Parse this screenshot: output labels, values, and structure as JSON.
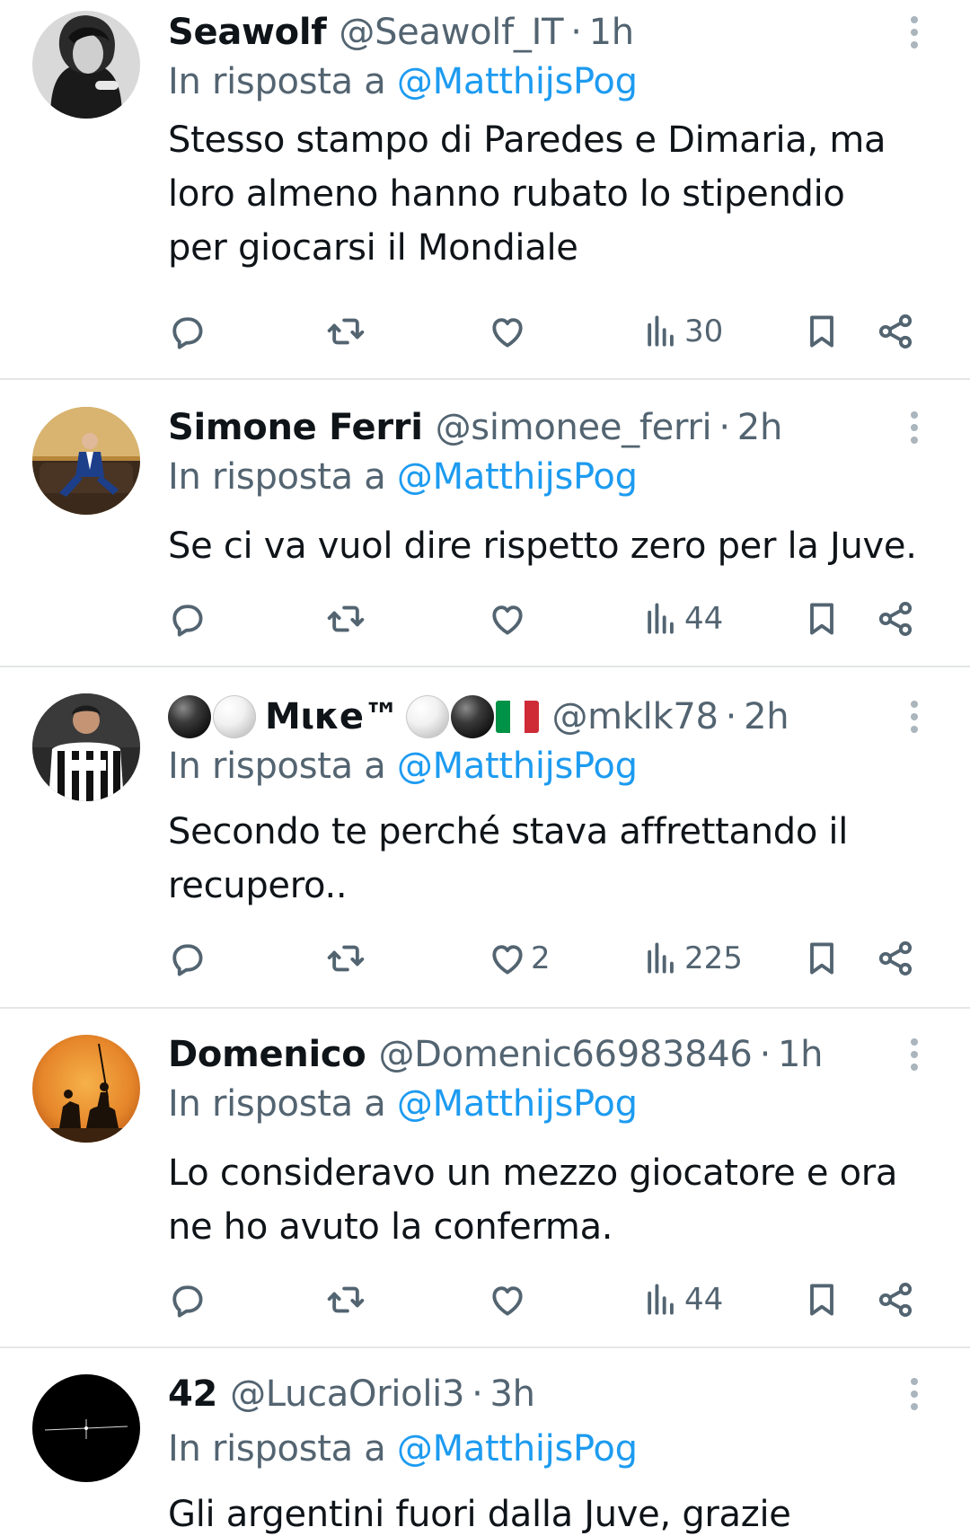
{
  "replies": [
    {
      "name": "Seawolf",
      "handle": "@Seawolf_IT",
      "time": "1h",
      "reply_prefix": "In risposta a",
      "reply_to": "@MatthijsPog",
      "lines": [
        "Stesso stampo di Paredes e Dimaria, ma",
        "loro almeno hanno rubato lo stipendio",
        "per giocarsi il Mondiale"
      ],
      "likes": "",
      "views": "30"
    },
    {
      "name": "Simone Ferri",
      "handle": "@simonee_ferri",
      "time": "2h",
      "reply_prefix": "In risposta a",
      "reply_to": "@MatthijsPog",
      "lines": [
        "Se ci va vuol dire rispetto zero per la Juve."
      ],
      "likes": "",
      "views": "44"
    },
    {
      "name": "Mικe™",
      "handle": "@mklk78",
      "time": "2h",
      "reply_prefix": "In risposta a",
      "reply_to": "@MatthijsPog",
      "lines": [
        "Secondo te perché stava affrettando il",
        "recupero.."
      ],
      "likes": "2",
      "views": "225"
    },
    {
      "name": "Domenico",
      "handle": "@Domenic66983846",
      "time": "1h",
      "reply_prefix": "In risposta a",
      "reply_to": "@MatthijsPog",
      "lines": [
        "Lo consideravo un mezzo giocatore e ora",
        "ne ho avuto la conferma."
      ],
      "likes": "",
      "views": "44"
    },
    {
      "name": "42",
      "handle": "@LucaOrioli3",
      "time": "3h",
      "reply_prefix": "In risposta a",
      "reply_to": "@MatthijsPog",
      "lines": [
        "Gli argentini fuori dalla Juve, grazie"
      ]
    }
  ],
  "separator": "·",
  "colors": {
    "text": "#0f1419",
    "secondary": "#536471",
    "mention": "#1d9bf0",
    "divider": "#e4e6e8"
  },
  "icons": [
    "reply-icon",
    "retweet-icon",
    "heart-icon",
    "views-icon",
    "bookmark-icon",
    "share-icon",
    "more-icon"
  ]
}
